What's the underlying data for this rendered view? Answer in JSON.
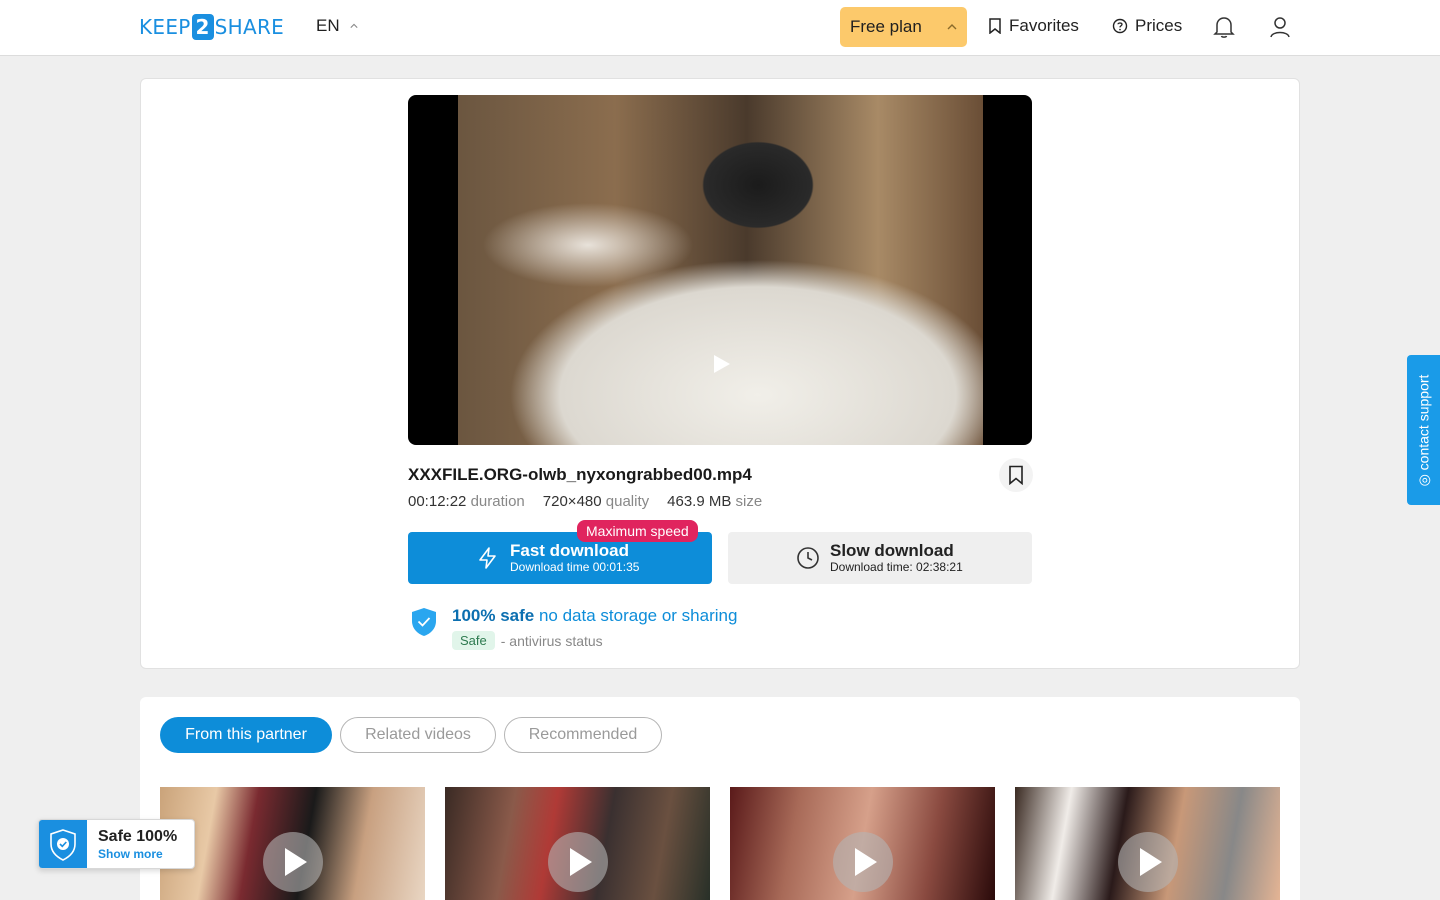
{
  "header": {
    "logo_left": "KEEP",
    "logo_num": "2",
    "logo_right": "SHARE",
    "language": "EN",
    "plan_label": "Free plan",
    "favorites_label": "Favorites",
    "prices_label": "Prices"
  },
  "file": {
    "name": "XXXFILE.ORG-olwb_nyxongrabbed00.mp4",
    "duration": "00:12:22",
    "duration_unit": "duration",
    "quality": "720×480",
    "quality_unit": "quality",
    "size": "463.9 MB",
    "size_unit": "size"
  },
  "download": {
    "fast_title": "Fast download",
    "fast_sub": "Download time 00:01:35",
    "badge": "Maximum speed",
    "slow_title": "Slow download",
    "slow_sub": "Download time: 02:38:21"
  },
  "safety": {
    "strong": "100% safe",
    "text": "no data storage or sharing",
    "av_badge": "Safe",
    "av_text": "- antivirus status"
  },
  "contact_label": "contact support",
  "tabs": [
    {
      "label": "From this partner",
      "active": true
    },
    {
      "label": "Related videos",
      "active": false
    },
    {
      "label": "Recommended",
      "active": false
    }
  ],
  "safe_popup": {
    "title": "Safe 100%",
    "link": "Show more"
  },
  "colors": {
    "accent": "#0d8dd9",
    "plan": "#fcc96b",
    "badge": "#e0245e"
  }
}
